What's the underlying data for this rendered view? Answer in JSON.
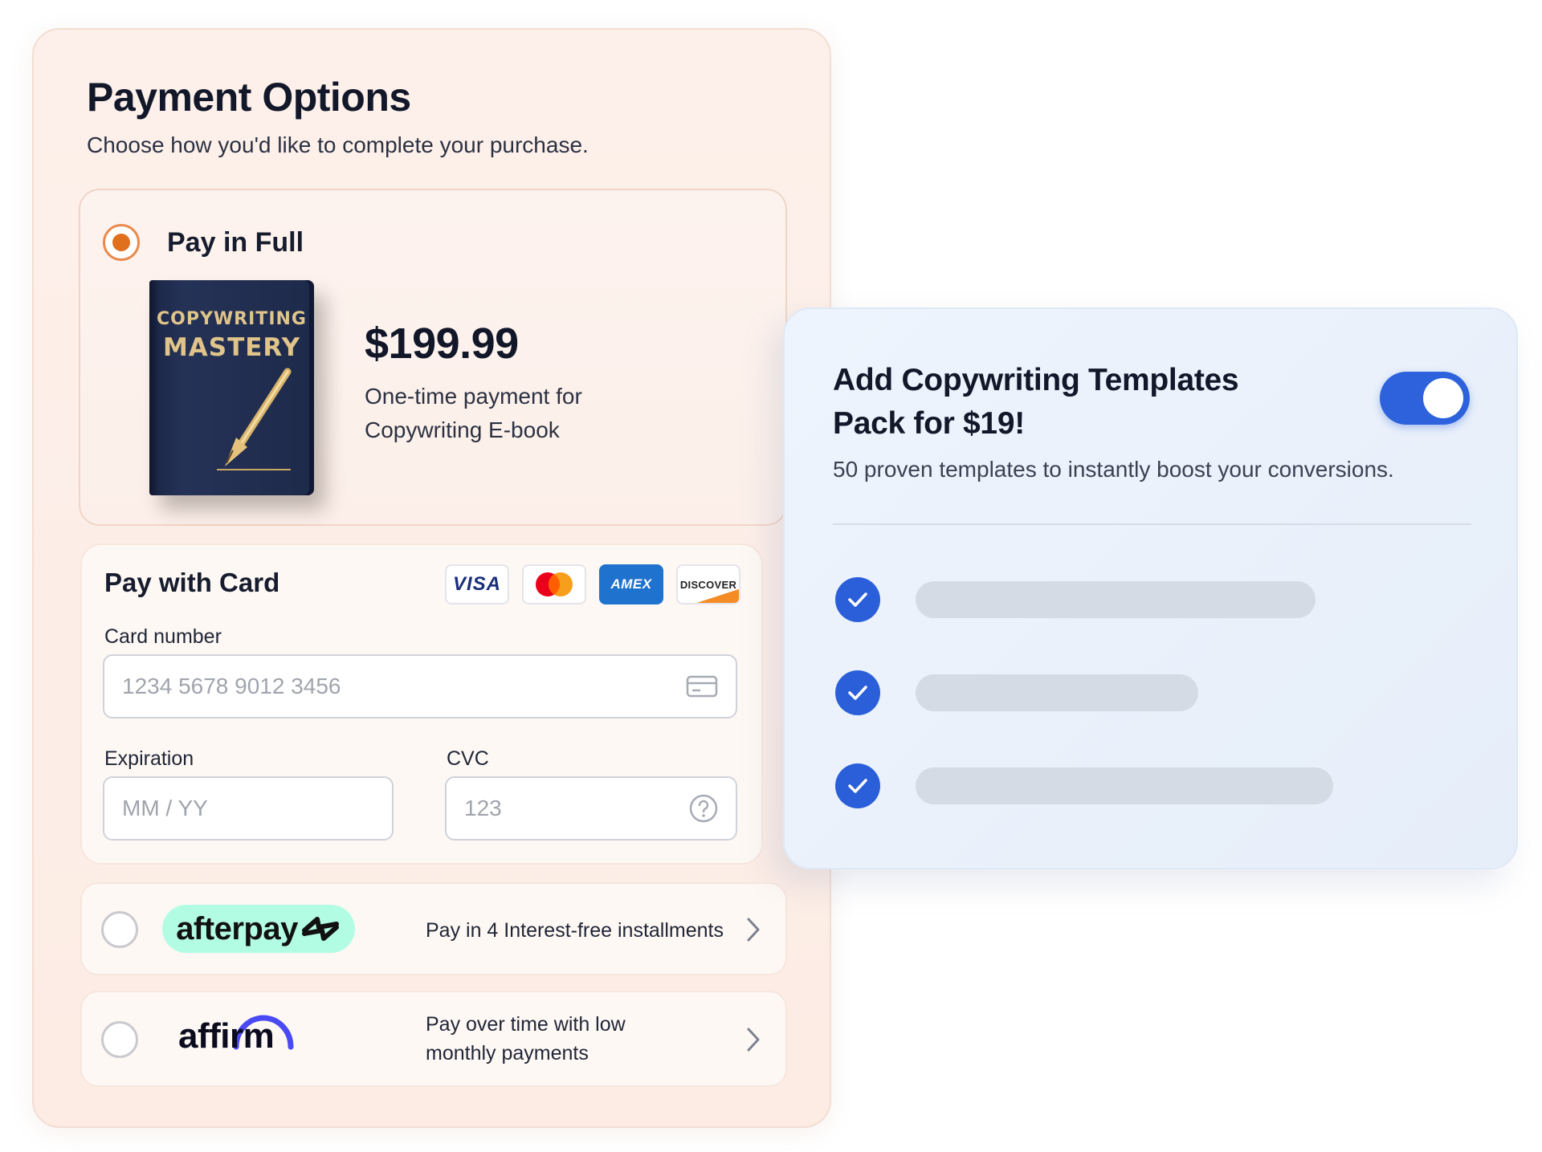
{
  "payment": {
    "title": "Payment Options",
    "subtitle": "Choose how you'd like to complete your purchase.",
    "full": {
      "label": "Pay in Full",
      "selected": true,
      "book_title_line1": "COPYWRITING",
      "book_title_line2": "MASTERY",
      "price": "$199.99",
      "description": "One-time payment for Copywriting E-book"
    },
    "card": {
      "title": "Pay with Card",
      "brands": {
        "visa": "VISA",
        "amex": "AMEX",
        "discover": "DISCOVER"
      },
      "card_number_label": "Card number",
      "card_number_placeholder": "1234 5678 9012 3456",
      "expiration_label": "Expiration",
      "expiration_placeholder": "MM / YY",
      "cvc_label": "CVC",
      "cvc_placeholder": "123"
    },
    "afterpay": {
      "logo": "afterpay",
      "description": "Pay in 4 Interest-free installments",
      "selected": false
    },
    "affirm": {
      "logo": "affirm",
      "description": "Pay over time with low monthly payments",
      "selected": false
    }
  },
  "addon": {
    "title": "Add Copywriting Templates Pack for $19!",
    "description": "50 proven templates to instantly boost your conversions.",
    "toggle_on": true,
    "feature_count": 3
  },
  "colors": {
    "accent_orange": "#e0701e",
    "toggle_blue": "#2d62dc",
    "check_blue": "#2b5fd9",
    "afterpay_mint": "#b2fce4",
    "affirm_purple": "#4a4af4",
    "amex_blue": "#1f72cd"
  },
  "icons": [
    "radio-selected-icon",
    "card-icon",
    "help-circle-icon",
    "chevron-right-icon",
    "check-circle-icon",
    "pen-icon"
  ]
}
